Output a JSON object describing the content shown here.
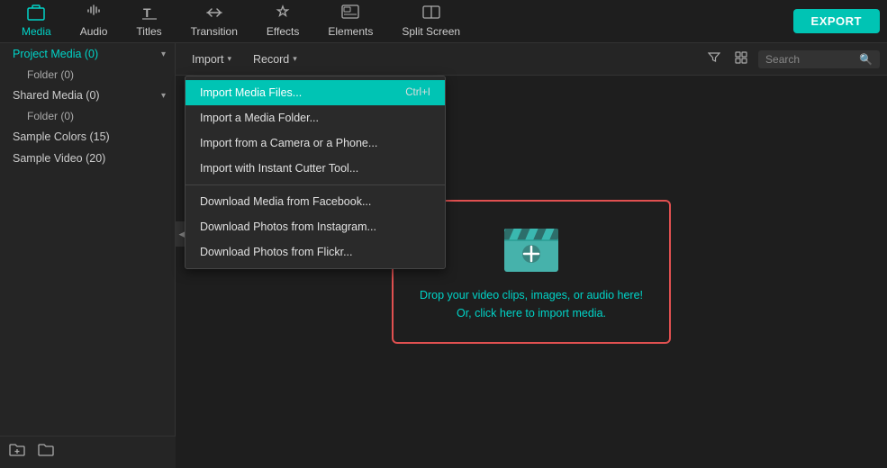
{
  "toolbar": {
    "export_label": "EXPORT",
    "items": [
      {
        "id": "media",
        "label": "Media",
        "icon": "📁",
        "active": true
      },
      {
        "id": "audio",
        "label": "Audio",
        "icon": "♪",
        "active": false
      },
      {
        "id": "titles",
        "label": "Titles",
        "icon": "T",
        "active": false
      },
      {
        "id": "transition",
        "label": "Transition",
        "icon": "⇄",
        "active": false
      },
      {
        "id": "effects",
        "label": "Effects",
        "icon": "✦",
        "active": false
      },
      {
        "id": "elements",
        "label": "Elements",
        "icon": "🖼",
        "active": false
      },
      {
        "id": "split_screen",
        "label": "Split Screen",
        "icon": "⊞",
        "active": false
      }
    ]
  },
  "sidebar": {
    "items": [
      {
        "id": "project_media",
        "label": "Project Media (0)",
        "expandable": true,
        "active": true
      },
      {
        "id": "folder",
        "label": "Folder (0)",
        "sub": true
      },
      {
        "id": "shared_media",
        "label": "Shared Media (0)",
        "expandable": true,
        "active": false
      },
      {
        "id": "shared_folder",
        "label": "Folder (0)",
        "sub": true
      },
      {
        "id": "sample_colors",
        "label": "Sample Colors (15)",
        "expandable": false,
        "active": false
      },
      {
        "id": "sample_video",
        "label": "Sample Video (20)",
        "expandable": false,
        "active": false
      }
    ],
    "bottom_icons": [
      "add_folder",
      "new_folder"
    ]
  },
  "content_toolbar": {
    "import_label": "Import",
    "record_label": "Record",
    "search_placeholder": "Search"
  },
  "import_menu": {
    "items": [
      {
        "id": "import_files",
        "label": "Import Media Files...",
        "shortcut": "Ctrl+I",
        "highlighted": true
      },
      {
        "id": "import_folder",
        "label": "Import a Media Folder...",
        "shortcut": ""
      },
      {
        "id": "import_camera",
        "label": "Import from a Camera or a Phone...",
        "shortcut": ""
      },
      {
        "id": "import_instant",
        "label": "Import with Instant Cutter Tool...",
        "shortcut": ""
      },
      {
        "id": "separator1",
        "separator": true
      },
      {
        "id": "download_facebook",
        "label": "Download Media from Facebook...",
        "shortcut": ""
      },
      {
        "id": "download_instagram",
        "label": "Download Photos from Instagram...",
        "shortcut": ""
      },
      {
        "id": "download_flickr",
        "label": "Download Photos from Flickr...",
        "shortcut": ""
      }
    ]
  },
  "drop_zone": {
    "line1": "Drop your video clips, images, or audio here!",
    "line2": "Or, click here to import media."
  }
}
